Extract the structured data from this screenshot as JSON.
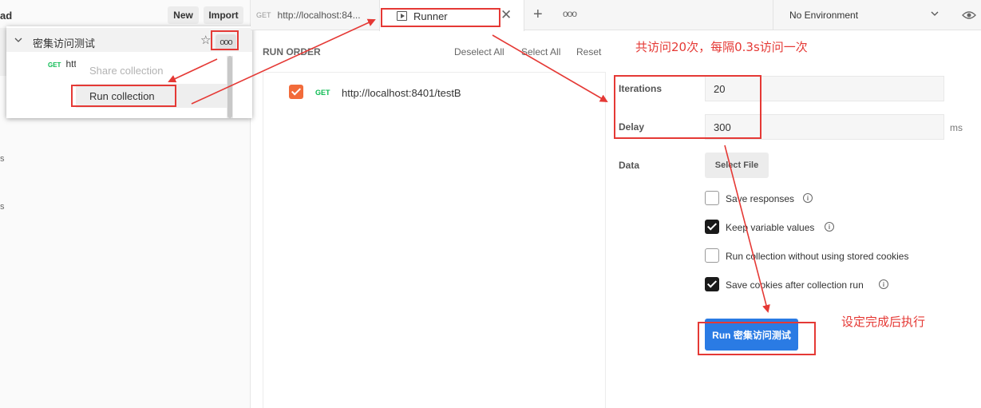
{
  "sidebar": {
    "header_fragment": "ad",
    "new_label": "New",
    "import_label": "Import",
    "edge_letters": [
      "s",
      "s"
    ]
  },
  "collection": {
    "name": "密集访问测试",
    "request_method": "GET",
    "request_fragment": "htt"
  },
  "context_menu": {
    "items": [
      "Share collection",
      "Run collection"
    ],
    "disabled": [
      true,
      false
    ]
  },
  "tabs": {
    "request_tab": {
      "method": "GET",
      "label": "http://localhost:84..."
    },
    "runner_tab": {
      "label": "Runner"
    },
    "more_label": "ooo"
  },
  "environment": {
    "label": "No Environment"
  },
  "run_order": {
    "title": "RUN ORDER",
    "deselect_all": "Deselect All",
    "select_all": "Select All",
    "reset": "Reset",
    "items": [
      {
        "method": "GET",
        "url": "http://localhost:8401/testB",
        "checked": true
      }
    ]
  },
  "settings": {
    "iterations_label": "Iterations",
    "iterations_value": "20",
    "delay_label": "Delay",
    "delay_value": "300",
    "delay_unit": "ms",
    "data_label": "Data",
    "select_file_label": "Select File",
    "options": [
      {
        "label": "Save responses",
        "checked": false,
        "info": true
      },
      {
        "label": "Keep variable values",
        "checked": true,
        "info": true
      },
      {
        "label": "Run collection without using stored cookies",
        "checked": false,
        "info": false
      },
      {
        "label": "Save cookies after collection run",
        "checked": true,
        "info": true
      }
    ],
    "run_button_label": "Run 密集访问测试"
  },
  "annotations": {
    "note_top": "共访问20次，每隔0.3s访问一次",
    "note_bottom": "设定完成后执行",
    "color": "#e53935"
  },
  "colors": {
    "accent_orange": "#f26b3a",
    "run_button": "#2a7be4",
    "get_method": "#0cbb52"
  }
}
